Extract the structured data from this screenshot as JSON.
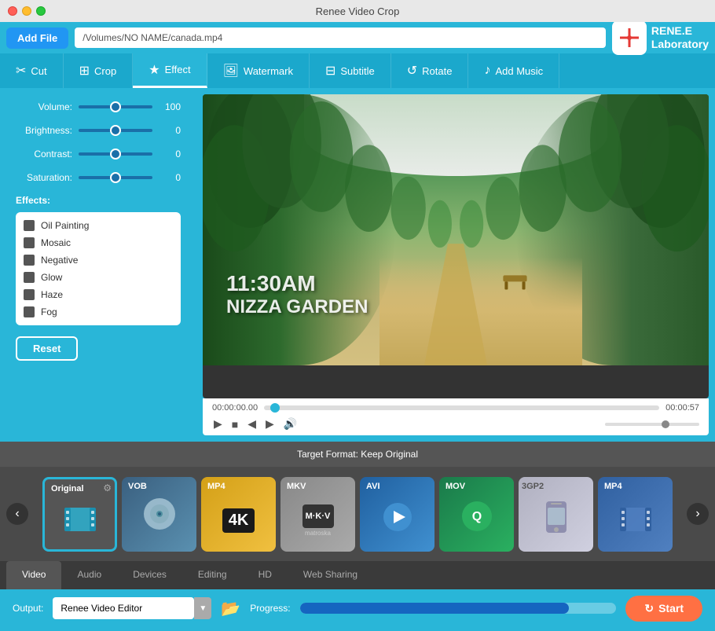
{
  "window": {
    "title": "Renee Video Crop"
  },
  "toolbar": {
    "add_file_label": "Add File",
    "file_path": "/Volumes/NO NAME/canada.mp4"
  },
  "logo": {
    "text_line1": "RENE.E",
    "text_line2": "Laboratory"
  },
  "nav_tabs": [
    {
      "id": "cut",
      "label": "Cut",
      "icon": "✂"
    },
    {
      "id": "crop",
      "label": "Crop",
      "icon": "⊞"
    },
    {
      "id": "effect",
      "label": "Effect",
      "icon": "★",
      "active": true
    },
    {
      "id": "watermark",
      "label": "Watermark",
      "icon": "🖼"
    },
    {
      "id": "subtitle",
      "label": "Subtitle",
      "icon": "⊟"
    },
    {
      "id": "rotate",
      "label": "Rotate",
      "icon": "↺"
    },
    {
      "id": "add_music",
      "label": "Add Music",
      "icon": "♪"
    }
  ],
  "effect_panel": {
    "volume_label": "Volume:",
    "volume_value": 100,
    "brightness_label": "Brightness:",
    "brightness_value": 0,
    "contrast_label": "Contrast:",
    "contrast_value": 0,
    "saturation_label": "Saturation:",
    "saturation_value": 0,
    "effects_label": "Effects:",
    "effects": [
      {
        "name": "Oil Painting",
        "checked": false
      },
      {
        "name": "Mosaic",
        "checked": false
      },
      {
        "name": "Negative",
        "checked": false
      },
      {
        "name": "Glow",
        "checked": false
      },
      {
        "name": "Haze",
        "checked": false
      },
      {
        "name": "Fog",
        "checked": false
      }
    ],
    "reset_label": "Reset"
  },
  "video": {
    "time_current": "00:00:00.00",
    "time_total": "00:00:57",
    "overlay_time": "11:30AM",
    "overlay_location": "NIZZA GARDEN"
  },
  "format_bar": {
    "label": "Target Format: Keep Original"
  },
  "format_items": [
    {
      "id": "original",
      "label": "Original",
      "icon": "🎬",
      "selected": true
    },
    {
      "id": "vob",
      "label": "VOB",
      "icon": "💿"
    },
    {
      "id": "mp4-4k",
      "label": "MP4",
      "sublabel": "4K",
      "icon": "4K"
    },
    {
      "id": "mkv",
      "label": "MKV",
      "icon": "M"
    },
    {
      "id": "avi",
      "label": "AVI",
      "icon": "▶"
    },
    {
      "id": "mov",
      "label": "MOV",
      "icon": "Q"
    },
    {
      "id": "3gp2",
      "label": "3GP2",
      "icon": "📱"
    },
    {
      "id": "mp4",
      "label": "MP4",
      "icon": "🎬"
    }
  ],
  "output_tabs": [
    {
      "label": "Video",
      "active": true
    },
    {
      "label": "Audio",
      "active": false
    },
    {
      "label": "Devices",
      "active": false
    },
    {
      "label": "Editing",
      "active": false
    },
    {
      "label": "HD",
      "active": false
    },
    {
      "label": "Web Sharing",
      "active": false
    }
  ],
  "bottom_bar": {
    "output_label": "Output:",
    "output_value": "Renee Video Editor",
    "progress_label": "Progress:",
    "start_label": "Start"
  }
}
